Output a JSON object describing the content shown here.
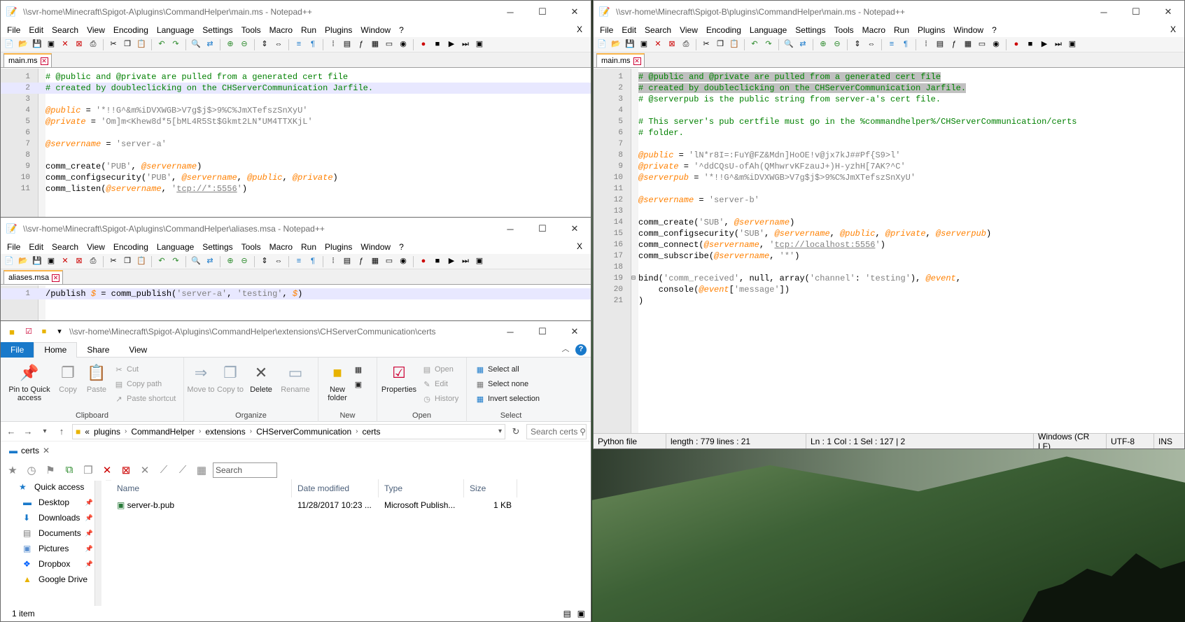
{
  "colors": {
    "accent": "#1979ca",
    "comment": "#008000",
    "variable": "#ff8000",
    "string": "#808080"
  },
  "npp_menu": [
    "File",
    "Edit",
    "Search",
    "View",
    "Encoding",
    "Language",
    "Settings",
    "Tools",
    "Macro",
    "Run",
    "Plugins",
    "Window",
    "?"
  ],
  "menu_close": "X",
  "win_a_main": {
    "title": "\\\\svr-home\\Minecraft\\Spigot-A\\plugins\\CommandHelper\\main.ms - Notepad++",
    "tab": "main.ms",
    "lines": [
      {
        "n": "1",
        "segs": [
          {
            "t": "# @public and @private are pulled from a generated cert file",
            "c": "comment"
          }
        ]
      },
      {
        "n": "2",
        "segs": [
          {
            "t": "# created by doubleclicking on the CHServerCommunication Jarfile.",
            "c": "comment"
          }
        ]
      },
      {
        "n": "3",
        "segs": []
      },
      {
        "n": "4",
        "segs": [
          {
            "t": "@public",
            "c": "var"
          },
          {
            "t": " = ",
            "c": "def"
          },
          {
            "t": "'*!!G^&m%iDVXWGB>V7g$j$>9%C%JmXTefszSnXyU'",
            "c": "str"
          }
        ]
      },
      {
        "n": "5",
        "segs": [
          {
            "t": "@private",
            "c": "var"
          },
          {
            "t": " = ",
            "c": "def"
          },
          {
            "t": "'Om]m<Khew8d*5[bML4R5St$Gkmt2LN*UM4TTXKjL'",
            "c": "str"
          }
        ]
      },
      {
        "n": "6",
        "segs": []
      },
      {
        "n": "7",
        "segs": [
          {
            "t": "@servername",
            "c": "var"
          },
          {
            "t": " = ",
            "c": "def"
          },
          {
            "t": "'server-a'",
            "c": "str"
          }
        ]
      },
      {
        "n": "8",
        "segs": []
      },
      {
        "n": "9",
        "segs": [
          {
            "t": "comm_create(",
            "c": "def"
          },
          {
            "t": "'PUB'",
            "c": "str"
          },
          {
            "t": ", ",
            "c": "def"
          },
          {
            "t": "@servername",
            "c": "var"
          },
          {
            "t": ")",
            "c": "def"
          }
        ]
      },
      {
        "n": "10",
        "segs": [
          {
            "t": "comm_configsecurity(",
            "c": "def"
          },
          {
            "t": "'PUB'",
            "c": "str"
          },
          {
            "t": ", ",
            "c": "def"
          },
          {
            "t": "@servername",
            "c": "var"
          },
          {
            "t": ", ",
            "c": "def"
          },
          {
            "t": "@public",
            "c": "var"
          },
          {
            "t": ", ",
            "c": "def"
          },
          {
            "t": "@private",
            "c": "var"
          },
          {
            "t": ")",
            "c": "def"
          }
        ]
      },
      {
        "n": "11",
        "segs": [
          {
            "t": "comm_listen(",
            "c": "def"
          },
          {
            "t": "@servername",
            "c": "var"
          },
          {
            "t": ", ",
            "c": "def"
          },
          {
            "t": "'",
            "c": "str"
          },
          {
            "t": "tcp://*:5556",
            "c": "url"
          },
          {
            "t": "'",
            "c": "str"
          },
          {
            "t": ")",
            "c": "def"
          }
        ]
      }
    ]
  },
  "win_a_alias": {
    "title": "\\\\svr-home\\Minecraft\\Spigot-A\\plugins\\CommandHelper\\aliases.msa - Notepad++",
    "tab": "aliases.msa",
    "lines": [
      {
        "n": "1",
        "segs": [
          {
            "t": "/publish ",
            "c": "def"
          },
          {
            "t": "$",
            "c": "var"
          },
          {
            "t": " = comm_publish(",
            "c": "def"
          },
          {
            "t": "'server-a'",
            "c": "str"
          },
          {
            "t": ", ",
            "c": "def"
          },
          {
            "t": "'testing'",
            "c": "str"
          },
          {
            "t": ", ",
            "c": "def"
          },
          {
            "t": "$",
            "c": "var"
          },
          {
            "t": ")",
            "c": "def"
          }
        ]
      }
    ]
  },
  "win_b_main": {
    "title": "\\\\svr-home\\Minecraft\\Spigot-B\\plugins\\CommandHelper\\main.ms - Notepad++",
    "tab": "main.ms",
    "lines": [
      {
        "n": "1",
        "segs": [
          {
            "t": "# @public and @private are pulled from a generated cert file",
            "c": "comment"
          }
        ]
      },
      {
        "n": "2",
        "segs": [
          {
            "t": "# created by doubleclicking on the CHServerCommunication Jarfile.",
            "c": "comment"
          }
        ]
      },
      {
        "n": "3",
        "segs": [
          {
            "t": "# @serverpub is the public string from server-a's cert file.",
            "c": "comment"
          }
        ]
      },
      {
        "n": "4",
        "segs": []
      },
      {
        "n": "5",
        "segs": [
          {
            "t": "# This server's pub certfile must go in the %commandhelper%/CHServerCommunication/certs",
            "c": "comment"
          }
        ]
      },
      {
        "n": "6",
        "segs": [
          {
            "t": "# folder.",
            "c": "comment"
          }
        ]
      },
      {
        "n": "7",
        "segs": []
      },
      {
        "n": "8",
        "segs": [
          {
            "t": "@public",
            "c": "var"
          },
          {
            "t": " = ",
            "c": "def"
          },
          {
            "t": "'lN*r8I=:FuY@FZ&Mdn]HoOE!v@jx7kJ##Pf{S9>l'",
            "c": "str"
          }
        ]
      },
      {
        "n": "9",
        "segs": [
          {
            "t": "@private",
            "c": "var"
          },
          {
            "t": " = ",
            "c": "def"
          },
          {
            "t": "'^ddCQsU-ofAh(QMhwrvKFzauJ+)H-yzhH[7AK?^C'",
            "c": "str"
          }
        ]
      },
      {
        "n": "10",
        "segs": [
          {
            "t": "@serverpub",
            "c": "var"
          },
          {
            "t": " = ",
            "c": "def"
          },
          {
            "t": "'*!!G^&m%iDVXWGB>V7g$j$>9%C%JmXTefszSnXyU'",
            "c": "str"
          }
        ]
      },
      {
        "n": "11",
        "segs": []
      },
      {
        "n": "12",
        "segs": [
          {
            "t": "@servername",
            "c": "var"
          },
          {
            "t": " = ",
            "c": "def"
          },
          {
            "t": "'server-b'",
            "c": "str"
          }
        ]
      },
      {
        "n": "13",
        "segs": []
      },
      {
        "n": "14",
        "segs": [
          {
            "t": "comm_create(",
            "c": "def"
          },
          {
            "t": "'SUB'",
            "c": "str"
          },
          {
            "t": ", ",
            "c": "def"
          },
          {
            "t": "@servername",
            "c": "var"
          },
          {
            "t": ")",
            "c": "def"
          }
        ]
      },
      {
        "n": "15",
        "segs": [
          {
            "t": "comm_configsecurity(",
            "c": "def"
          },
          {
            "t": "'SUB'",
            "c": "str"
          },
          {
            "t": ", ",
            "c": "def"
          },
          {
            "t": "@servername",
            "c": "var"
          },
          {
            "t": ", ",
            "c": "def"
          },
          {
            "t": "@public",
            "c": "var"
          },
          {
            "t": ", ",
            "c": "def"
          },
          {
            "t": "@private",
            "c": "var"
          },
          {
            "t": ", ",
            "c": "def"
          },
          {
            "t": "@serverpub",
            "c": "var"
          },
          {
            "t": ")",
            "c": "def"
          }
        ]
      },
      {
        "n": "16",
        "segs": [
          {
            "t": "comm_connect(",
            "c": "def"
          },
          {
            "t": "@servername",
            "c": "var"
          },
          {
            "t": ", ",
            "c": "def"
          },
          {
            "t": "'",
            "c": "str"
          },
          {
            "t": "tcp://localhost:5556",
            "c": "url"
          },
          {
            "t": "'",
            "c": "str"
          },
          {
            "t": ")",
            "c": "def"
          }
        ]
      },
      {
        "n": "17",
        "segs": [
          {
            "t": "comm_subscribe(",
            "c": "def"
          },
          {
            "t": "@servername",
            "c": "var"
          },
          {
            "t": ", ",
            "c": "def"
          },
          {
            "t": "'*'",
            "c": "str"
          },
          {
            "t": ")",
            "c": "def"
          }
        ]
      },
      {
        "n": "18",
        "segs": []
      },
      {
        "n": "19",
        "segs": [
          {
            "t": "bind(",
            "c": "def"
          },
          {
            "t": "'comm_received'",
            "c": "str"
          },
          {
            "t": ", null, array(",
            "c": "def"
          },
          {
            "t": "'channel'",
            "c": "str"
          },
          {
            "t": ": ",
            "c": "def"
          },
          {
            "t": "'testing'",
            "c": "str"
          },
          {
            "t": "), ",
            "c": "def"
          },
          {
            "t": "@event",
            "c": "var"
          },
          {
            "t": ",",
            "c": "def"
          }
        ]
      },
      {
        "n": "20",
        "segs": [
          {
            "t": "    console(",
            "c": "def"
          },
          {
            "t": "@event",
            "c": "var"
          },
          {
            "t": "[",
            "c": "def"
          },
          {
            "t": "'message'",
            "c": "str"
          },
          {
            "t": "])",
            "c": "def"
          }
        ]
      },
      {
        "n": "21",
        "segs": [
          {
            "t": ")",
            "c": "def"
          }
        ]
      }
    ],
    "status": {
      "lang": "Python file",
      "length": "length : 779    lines : 21",
      "pos": "Ln : 1    Col : 1    Sel : 127 | 2",
      "eol": "Windows (CR LF)",
      "enc": "UTF-8",
      "ins": "INS"
    }
  },
  "explorer": {
    "title": "\\\\svr-home\\Minecraft\\Spigot-A\\plugins\\CommandHelper\\extensions\\CHServerCommunication\\certs",
    "tabs": [
      "File",
      "Home",
      "Share",
      "View"
    ],
    "clipboard": {
      "pin": "Pin to Quick access",
      "copy": "Copy",
      "paste": "Paste",
      "cut": "Cut",
      "copy_path": "Copy path",
      "paste_shortcut": "Paste shortcut",
      "label": "Clipboard"
    },
    "organize": {
      "move": "Move to",
      "copy": "Copy to",
      "delete": "Delete",
      "rename": "Rename",
      "label": "Organize"
    },
    "new": {
      "folder": "New folder",
      "label": "New"
    },
    "open": {
      "properties": "Properties",
      "open": "Open",
      "edit": "Edit",
      "history": "History",
      "label": "Open"
    },
    "select": {
      "all": "Select all",
      "none": "Select none",
      "invert": "Invert selection",
      "label": "Select"
    },
    "breadcrumb": [
      "«",
      "plugins",
      "CommandHelper",
      "extensions",
      "CHServerCommunication",
      "certs"
    ],
    "search_placeholder": "Search certs",
    "qtab": "certs",
    "qsearch": "Search",
    "nav": [
      {
        "label": "Quick access",
        "pin": ""
      },
      {
        "label": "Desktop",
        "pin": "📌"
      },
      {
        "label": "Downloads",
        "pin": "📌"
      },
      {
        "label": "Documents",
        "pin": "📌"
      },
      {
        "label": "Pictures",
        "pin": "📌"
      },
      {
        "label": "Dropbox",
        "pin": "📌"
      },
      {
        "label": "Google Drive",
        "pin": ""
      }
    ],
    "columns": [
      "Name",
      "Date modified",
      "Type",
      "Size"
    ],
    "files": [
      {
        "name": "server-b.pub",
        "date": "11/28/2017 10:23 ...",
        "type": "Microsoft Publish...",
        "size": "1 KB"
      }
    ],
    "status": "1 item"
  }
}
